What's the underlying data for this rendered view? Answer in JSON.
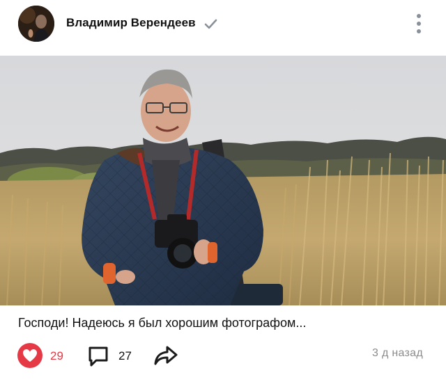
{
  "post": {
    "author_name": "Владимир Верендеев",
    "caption": "Господи! Надеюсь я был хорошим фотографом...",
    "likes": "29",
    "comments": "27",
    "timestamp": "3 д назад"
  },
  "colors": {
    "like_accent": "#e63946",
    "verified_check": "#8a9099",
    "muted_text": "#8c8c8c"
  },
  "icons": {
    "verified": "check-icon",
    "more": "more-vertical-icon",
    "like": "heart-icon",
    "comment": "comment-icon",
    "share": "share-arrow-icon"
  }
}
